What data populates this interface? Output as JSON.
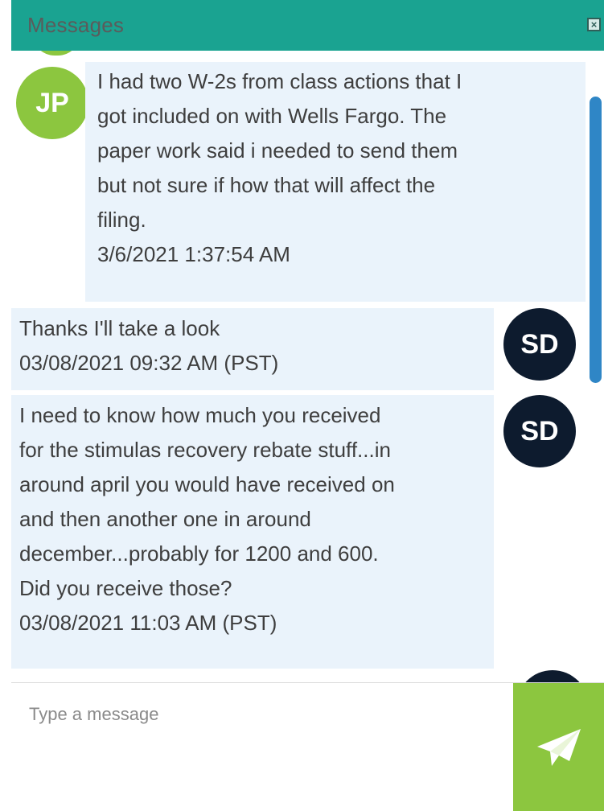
{
  "window": {
    "title": "Messages",
    "close_glyph": "×"
  },
  "messages": [
    {
      "sender_initials": "JP",
      "text_lines": [
        "I had two W-2s from class actions that I",
        "got included on with Wells Fargo. The",
        "paper work said i needed to send them",
        "but not sure if how that will affect the",
        "filing."
      ],
      "timestamp": "3/6/2021 1:37:54 AM",
      "avatar_color": "#8cc63f"
    },
    {
      "sender_initials": "SD",
      "text_lines": [
        "Thanks I'll take a look"
      ],
      "timestamp": "03/08/2021 09:32 AM (PST)",
      "avatar_color": "#0d1b2e"
    },
    {
      "sender_initials": "SD",
      "text_lines": [
        "I need to know how much you received",
        "for the stimulas recovery rebate stuff...in",
        "around april you would have received on",
        "and then another one in around",
        "december...probably for 1200 and 600.",
        "Did you receive those?"
      ],
      "timestamp": "03/08/2021 11:03 AM (PST)",
      "avatar_color": "#0d1b2e"
    }
  ],
  "composer": {
    "placeholder": "Type a message",
    "value": ""
  },
  "colors": {
    "header": "#1aa391",
    "bubble": "#eaf3fb",
    "send_button": "#8cc63f",
    "scrollbar": "#2f86c6"
  },
  "icons": {
    "close": "close-icon",
    "send": "paper-plane-icon"
  }
}
